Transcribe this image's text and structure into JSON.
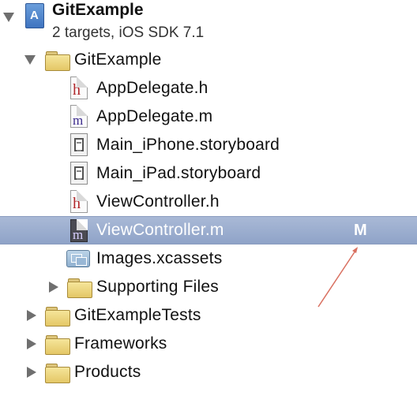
{
  "navigator": {
    "project": {
      "name": "GitExample",
      "subtitle": "2 targets, iOS SDK 7.1"
    },
    "items": [
      {
        "label": "GitExample",
        "kind": "folder",
        "expanded": true
      },
      {
        "label": "AppDelegate.h",
        "kind": "header-file",
        "icon_text": "h"
      },
      {
        "label": "AppDelegate.m",
        "kind": "implementation-file",
        "icon_text": "m"
      },
      {
        "label": "Main_iPhone.storyboard",
        "kind": "storyboard-file"
      },
      {
        "label": "Main_iPad.storyboard",
        "kind": "storyboard-file"
      },
      {
        "label": "ViewController.h",
        "kind": "header-file",
        "icon_text": "h"
      },
      {
        "label": "ViewController.m",
        "kind": "implementation-file",
        "icon_text": "m",
        "selected": true,
        "status": "M"
      },
      {
        "label": "Images.xcassets",
        "kind": "asset-catalog"
      },
      {
        "label": "Supporting Files",
        "kind": "folder",
        "expanded": false
      },
      {
        "label": "GitExampleTests",
        "kind": "folder",
        "expanded": false
      },
      {
        "label": "Frameworks",
        "kind": "folder",
        "expanded": false
      },
      {
        "label": "Products",
        "kind": "folder",
        "expanded": false
      }
    ]
  },
  "colors": {
    "selection": "#9fb1d2",
    "annotation_arrow": "#d97060",
    "folder": "#f0dd8a"
  }
}
